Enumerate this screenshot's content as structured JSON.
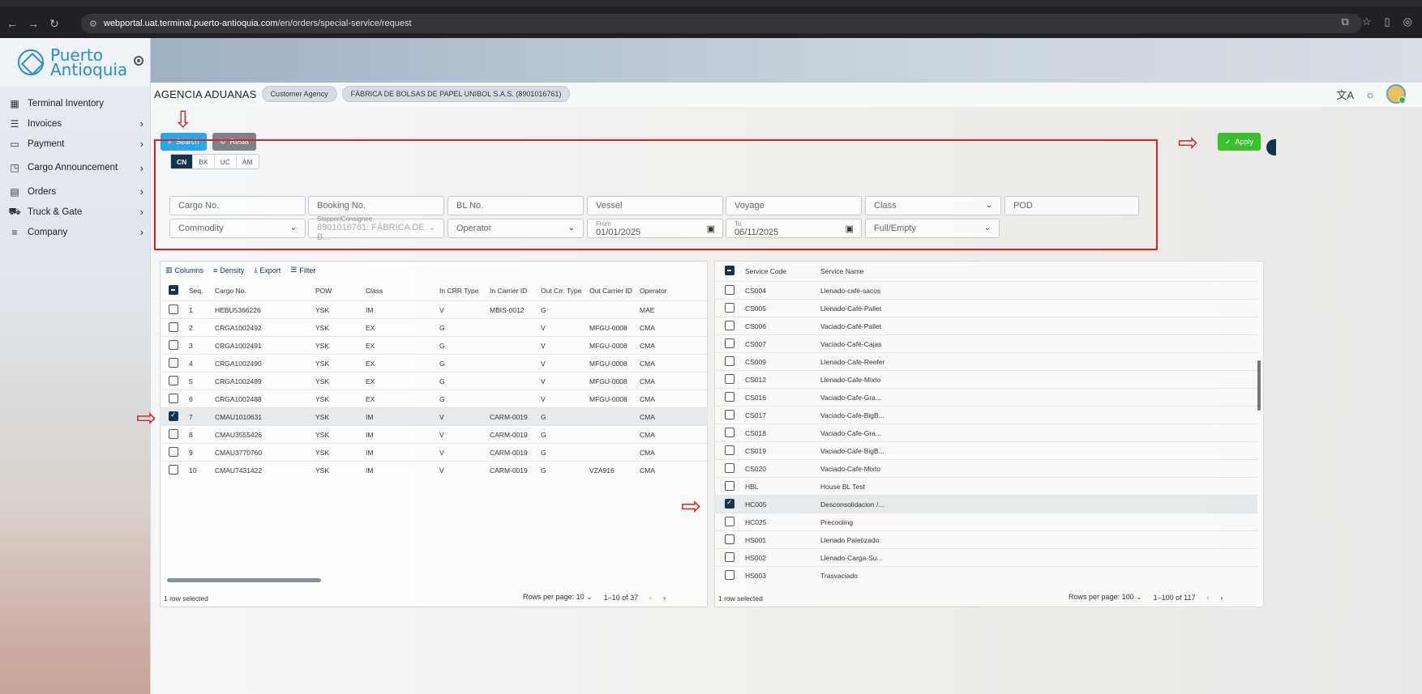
{
  "browser": {
    "url_host": "webportal.uat.terminal.puerto-antioquia.com",
    "url_path": "/en/orders/special-service/request"
  },
  "brand": {
    "line1": "Puerto",
    "line2": "Antioquia"
  },
  "sidebar": {
    "items": [
      {
        "label": "Terminal Inventory",
        "icon": "grid-icon"
      },
      {
        "label": "Invoices",
        "icon": "invoice-icon"
      },
      {
        "label": "Payment",
        "icon": "card-icon"
      },
      {
        "label": "Cargo Announcement",
        "icon": "announcement-icon"
      },
      {
        "label": "Orders",
        "icon": "orders-icon"
      },
      {
        "label": "Truck & Gate",
        "icon": "truck-icon"
      },
      {
        "label": "Company",
        "icon": "company-icon"
      }
    ]
  },
  "header": {
    "agency_name": "AGENCIA ADUANAS",
    "agency_type": "Customer Agency",
    "company": "FÁBRICA DE BOLSAS DE PAPEL UNIBOL S.A.S. (8901016761)"
  },
  "actions": {
    "search": "Search",
    "reset": "Reset",
    "apply": "Apply"
  },
  "filters": {
    "tabs": [
      "CN",
      "BK",
      "UC",
      "AM"
    ],
    "cargo_no": "Cargo No.",
    "booking_no": "Booking No.",
    "bl_no": "BL No.",
    "vessel": "Vessel",
    "voyage": "Voyage",
    "class": "Class",
    "pod": "POD",
    "commodity": "Commodity",
    "shipper_label": "Shipper/Consignee",
    "shipper_value": "8901016761: FÁBRICA DE B...",
    "operator": "Operator",
    "from_label": "From",
    "from_value": "01/01/2025",
    "to_label": "To",
    "to_value": "06/11/2025",
    "full_empty": "Full/Empty"
  },
  "cargo_toolbar": {
    "columns": "Columns",
    "density": "Density",
    "export": "Export",
    "filter": "Filter"
  },
  "cargo_table": {
    "headers": [
      "Seq.",
      "Cargo No.",
      "POW",
      "Class",
      "In CRR Type",
      "In Carrier ID",
      "Out Crr. Type",
      "Out Carrier ID",
      "Operator"
    ],
    "rows": [
      {
        "seq": "1",
        "cargo": "HEBU5366226",
        "pow": "YSK",
        "class": "IM",
        "in_type": "V",
        "in_id": "MBIS-0012",
        "out_type": "G",
        "out_id": "",
        "op": "MAE",
        "checked": false
      },
      {
        "seq": "2",
        "cargo": "CRGA1002492",
        "pow": "YSK",
        "class": "EX",
        "in_type": "G",
        "in_id": "",
        "out_type": "V",
        "out_id": "MFGU-0008",
        "op": "CMA",
        "checked": false
      },
      {
        "seq": "3",
        "cargo": "CRGA1002491",
        "pow": "YSK",
        "class": "EX",
        "in_type": "G",
        "in_id": "",
        "out_type": "V",
        "out_id": "MFGU-0008",
        "op": "CMA",
        "checked": false
      },
      {
        "seq": "4",
        "cargo": "CRGA1002490",
        "pow": "YSK",
        "class": "EX",
        "in_type": "G",
        "in_id": "",
        "out_type": "V",
        "out_id": "MFGU-0008",
        "op": "CMA",
        "checked": false
      },
      {
        "seq": "5",
        "cargo": "CRGA1002489",
        "pow": "YSK",
        "class": "EX",
        "in_type": "G",
        "in_id": "",
        "out_type": "V",
        "out_id": "MFGU-0008",
        "op": "CMA",
        "checked": false
      },
      {
        "seq": "6",
        "cargo": "CRGA1002488",
        "pow": "YSK",
        "class": "EX",
        "in_type": "G",
        "in_id": "",
        "out_type": "V",
        "out_id": "MFGU-0008",
        "op": "CMA",
        "checked": false
      },
      {
        "seq": "7",
        "cargo": "CMAU1010631",
        "pow": "YSK",
        "class": "IM",
        "in_type": "V",
        "in_id": "CARM-0019",
        "out_type": "G",
        "out_id": "",
        "op": "CMA",
        "checked": true
      },
      {
        "seq": "8",
        "cargo": "CMAU3555426",
        "pow": "YSK",
        "class": "IM",
        "in_type": "V",
        "in_id": "CARM-0019",
        "out_type": "G",
        "out_id": "",
        "op": "CMA",
        "checked": false
      },
      {
        "seq": "9",
        "cargo": "CMAU3770760",
        "pow": "YSK",
        "class": "IM",
        "in_type": "V",
        "in_id": "CARM-0019",
        "out_type": "G",
        "out_id": "",
        "op": "CMA",
        "checked": false
      },
      {
        "seq": "10",
        "cargo": "CMAU7431422",
        "pow": "YSK",
        "class": "IM",
        "in_type": "V",
        "in_id": "CARM-0019",
        "out_type": "G",
        "out_id": "VZA916",
        "op": "CMA",
        "checked": false
      }
    ],
    "footer_selected": "1 row selected",
    "rows_per_page_label": "Rows per page:",
    "rows_per_page": "10",
    "range": "1–10 of 37"
  },
  "service_table": {
    "headers": [
      "Service Code",
      "Service Name"
    ],
    "rows": [
      {
        "code": "CS004",
        "name": "Llenado-café-sacos",
        "checked": false
      },
      {
        "code": "CS005",
        "name": "Llenado-Café-Pallet",
        "checked": false
      },
      {
        "code": "CS006",
        "name": "Vaciado-Café-Pallet",
        "checked": false
      },
      {
        "code": "CS007",
        "name": "Vaciado-Café-Cajas",
        "checked": false
      },
      {
        "code": "CS009",
        "name": "Llenado-Cafe-Reefer",
        "checked": false
      },
      {
        "code": "CS012",
        "name": "Llenado-Cafe-Mixto",
        "checked": false
      },
      {
        "code": "CS016",
        "name": "Vaciado-Cafe-Gra...",
        "checked": false
      },
      {
        "code": "CS017",
        "name": "Vaciado-Cafe-BigB...",
        "checked": false
      },
      {
        "code": "CS018",
        "name": "Vaciado-Cafe-Gra...",
        "checked": false
      },
      {
        "code": "CS019",
        "name": "Vaciado-Cafe-BigB...",
        "checked": false
      },
      {
        "code": "CS020",
        "name": "Vaciado-Cafe-Mixto",
        "checked": false
      },
      {
        "code": "HBL",
        "name": "House BL Test",
        "checked": false
      },
      {
        "code": "HC005",
        "name": "Desconsolidacion /...",
        "checked": true
      },
      {
        "code": "HC025",
        "name": "Precooling",
        "checked": false
      },
      {
        "code": "HS001",
        "name": "Llenado Paletizado",
        "checked": false
      },
      {
        "code": "HS002",
        "name": "Llenado-Carga-Su...",
        "checked": false
      },
      {
        "code": "HS003",
        "name": "Trasvaciado",
        "checked": false
      }
    ],
    "footer_selected": "1 row selected",
    "rows_per_page_label": "Rows per page:",
    "rows_per_page": "100",
    "range": "1–100 of 117"
  },
  "colors": {
    "accent_dark": "#12344f",
    "search": "#2aa7e6",
    "apply": "#3bbf2e",
    "annotation": "#e02020"
  }
}
